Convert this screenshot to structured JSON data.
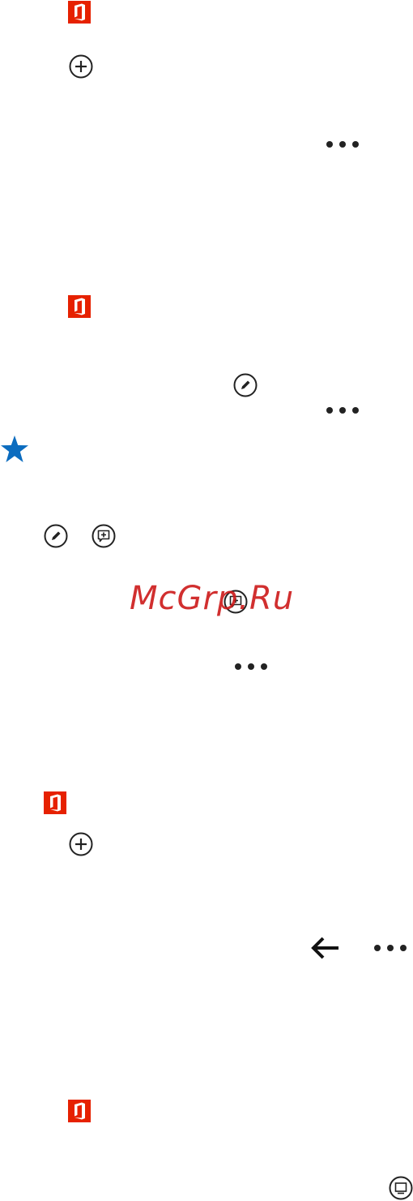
{
  "watermark": {
    "text": "McGrp.Ru",
    "color": "#cc1818"
  },
  "colors": {
    "office_red": "#e62100",
    "star_blue": "#0b6cbf",
    "icon_dark": "#222222"
  },
  "icons": [
    "office-logo-icon",
    "add-circle-icon",
    "more-icon",
    "edit-circle-icon",
    "favorite-star-icon",
    "add-comment-icon",
    "back-arrow-icon",
    "slideshow-icon"
  ]
}
